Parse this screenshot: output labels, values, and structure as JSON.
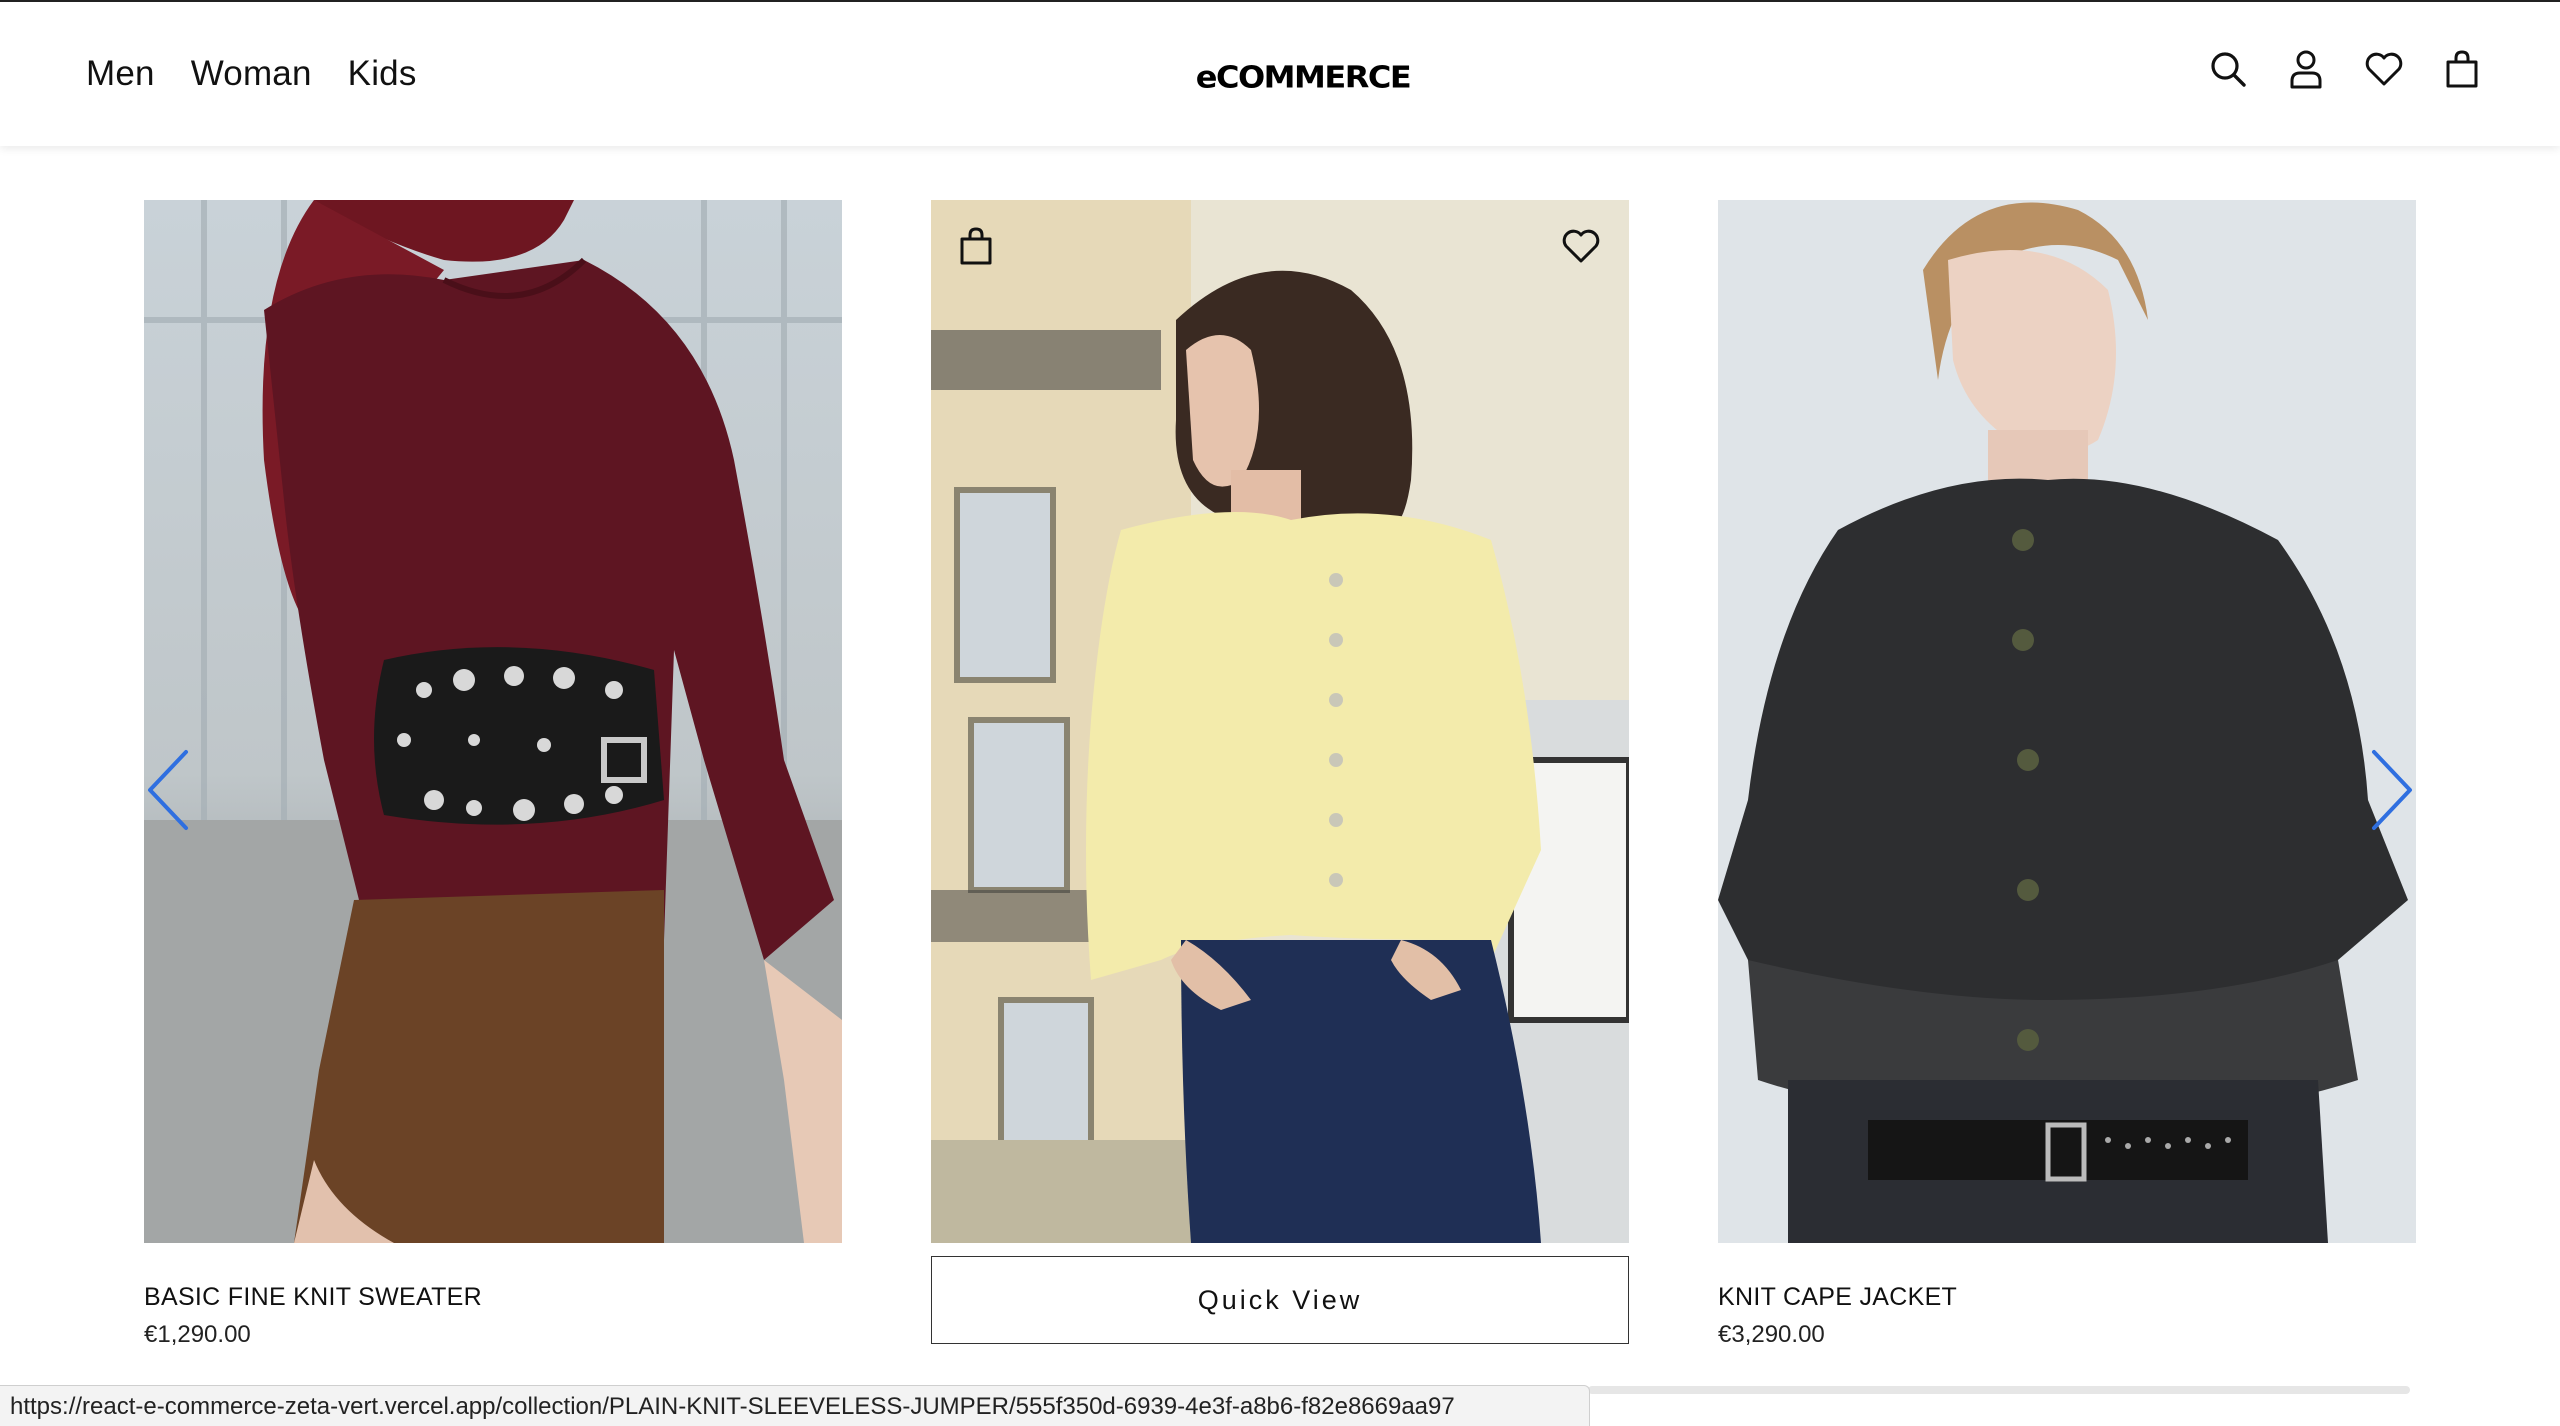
{
  "header": {
    "nav": [
      "Men",
      "Woman",
      "Kids"
    ],
    "logo": "eCOMMERCE",
    "icons": [
      "search-icon",
      "account-icon",
      "wishlist-heart-icon",
      "shopping-bag-icon"
    ]
  },
  "products": [
    {
      "title": "BASIC FINE KNIT SWEATER",
      "price": "€1,290.00"
    },
    {
      "quick_view_label": "Quick View"
    },
    {
      "title": "KNIT CAPE JACKET",
      "price": "€3,290.00"
    }
  ],
  "carousel": {
    "prev_icon": "chevron-left-icon",
    "next_icon": "chevron-right-icon",
    "accent_color": "#2f6fe0"
  },
  "status_bar": {
    "url": "https://react-e-commerce-zeta-vert.vercel.app/collection/PLAIN-KNIT-SLEEVELESS-JUMPER/555f350d-6939-4e3f-a8b6-f82e8669aa97"
  }
}
